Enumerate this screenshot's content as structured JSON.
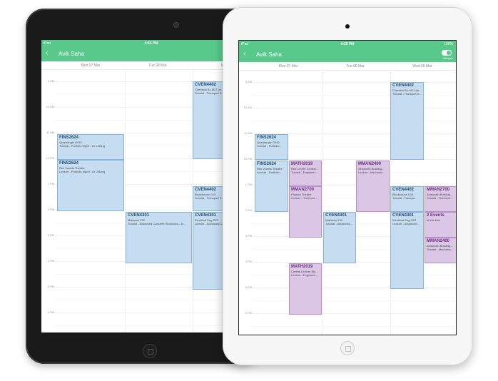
{
  "black_ipad": {
    "status": {
      "carrier": "iPad",
      "time": "4:54 PM"
    },
    "nav": {
      "title": "Avik Saha"
    },
    "days": [
      "Mon 07 Mar",
      "Tue 08 Mar",
      "Wed"
    ],
    "hours": [
      "9 AM",
      "10 AM",
      "11 AM",
      "12 PM",
      "1 PM",
      "2 PM",
      "3 PM",
      "4 PM",
      "5 PM",
      "6 PM"
    ],
    "events": [
      {
        "code": "CVEN4402",
        "room": "Chemical Sc M17 (m...",
        "desc": "Tutorial - Transport S..."
      },
      {
        "code": "FINS2624",
        "room": "Quadrangle G042",
        "desc": "Tutorial - Portfolio Mgmt - Dr J Bang"
      },
      {
        "code": "FINS2624",
        "room": "Rex Vowels Theatre",
        "desc": "Lecture - Portfolio Mgmt - Dr J Bang"
      },
      {
        "code": "CVEN4402",
        "room": "Blockhouse G15",
        "desc": "Tutorial - Transport S..."
      },
      {
        "code": "CVEN4301",
        "room": "Mathews 230",
        "desc": "Tutorial - Advanced Concrete Structures - M..."
      },
      {
        "code": "CVEN4301",
        "room": "Electrical Eng G22",
        "desc": "Lecture - Advanced Co..."
      }
    ]
  },
  "white_ipad": {
    "status": {
      "carrier": "iPad",
      "time": "4:25 PM",
      "battery": "100%"
    },
    "nav": {
      "title": "Avik Saha",
      "toggle_label": "Villagee"
    },
    "days": [
      "Mon 07 Mar",
      "Tue 08 Mar",
      "Wed 09 Mar"
    ],
    "hours": [
      "9 AM",
      "10 AM",
      "11 AM",
      "12 PM",
      "1 PM",
      "2 PM",
      "3 PM",
      "4 PM",
      "5 PM",
      "6 PM"
    ],
    "events": [
      {
        "code": "CVEN4402",
        "room": "Chemical Sc M17 (m...",
        "desc": "Tutorial - Transport S..."
      },
      {
        "code": "FINS2624",
        "room": "Quadrangle G042",
        "desc": "Tutorial - Portfolio..."
      },
      {
        "code": "FINS2624",
        "room": "Rex Vowels Theatre",
        "desc": "Lecture - Portfolio..."
      },
      {
        "code": "MATH2019",
        "room": "Red Centre Central...",
        "desc": "Tutorial - Engineeri..."
      },
      {
        "code": "MMAN2400",
        "room": "Ainsworth Building...",
        "desc": "Lecture - Mechanic..."
      },
      {
        "code": "MMAN2700",
        "room": "Physics Theatre",
        "desc": "Lecture - Thermod..."
      },
      {
        "code": "CVEN4402",
        "room": "Blockhouse G15",
        "desc": "Tutorial - Transpo..."
      },
      {
        "code": "MMAN2700",
        "room": "Ainsworth Building...",
        "desc": "Tutorial - Thermod..."
      },
      {
        "code": "CVEN4301",
        "room": "Mathews 230",
        "desc": "Tutorial - Advanced..."
      },
      {
        "code": "CVEN4301",
        "room": "Electrical Eng G22",
        "desc": "Lecture - Advanced..."
      },
      {
        "code": "2 Events",
        "room": "at this time",
        "desc": ""
      },
      {
        "code": "MMAN2400",
        "room": "Ainsworth Building...",
        "desc": "Tutorial - Mechanic..."
      },
      {
        "code": "MATH2019",
        "room": "Central Lecture Blo...",
        "desc": "Lecture - Engineeri..."
      }
    ]
  },
  "colors": {
    "header": "#58c98b",
    "event_blue": "#c6dcf1",
    "event_purple": "#dcc6e6"
  }
}
